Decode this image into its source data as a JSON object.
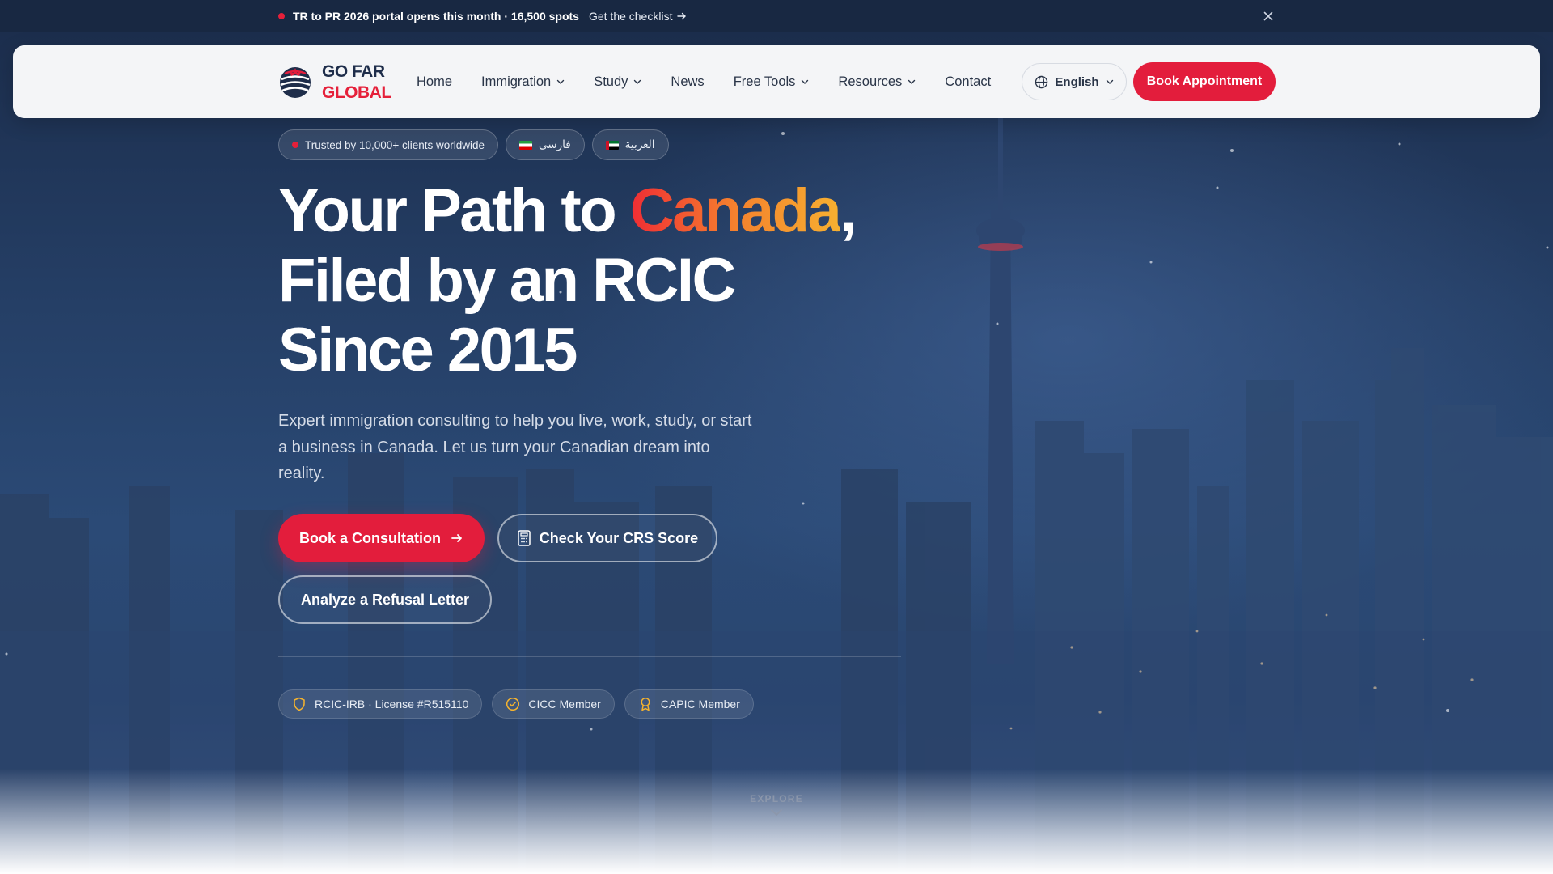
{
  "announcement": {
    "text": "TR to PR 2026 portal opens this month · 16,500 spots",
    "link": "Get the checklist",
    "close": "×"
  },
  "brand": {
    "line1": "GO FAR",
    "line2": "GLOBAL",
    "primary_color": "#e31d3c",
    "navy_color": "#1e2d4a"
  },
  "nav": {
    "items": [
      {
        "label": "Home",
        "dropdown": false
      },
      {
        "label": "Immigration",
        "dropdown": true
      },
      {
        "label": "Study",
        "dropdown": true
      },
      {
        "label": "News",
        "dropdown": false
      },
      {
        "label": "Free Tools",
        "dropdown": true
      },
      {
        "label": "Resources",
        "dropdown": true
      },
      {
        "label": "Contact",
        "dropdown": false
      }
    ],
    "language": "English",
    "book_button": "Book Appointment"
  },
  "hero": {
    "trust_pill": "Trusted by 10,000+ clients worldwide",
    "lang_farsi": "فارسی",
    "lang_arabic": "العربية",
    "headline_pre": "Your Path to ",
    "headline_accent": "Canada",
    "headline_post": ", Filed by an RCIC Since 2015",
    "subtext": "Expert immigration consulting to help you live, work, study, or start a business in Canada. Let us turn your Canadian dream into reality.",
    "cta_primary": "Book a Consultation",
    "cta_crs": "Check Your CRS Score",
    "cta_refusal": "Analyze a Refusal Letter",
    "badges": [
      {
        "label": "RCIC-IRB · License #R515110",
        "icon": "shield-icon"
      },
      {
        "label": "CICC Member",
        "icon": "check-circle-icon"
      },
      {
        "label": "CAPIC Member",
        "icon": "award-icon"
      }
    ],
    "explore": "EXPLORE"
  }
}
